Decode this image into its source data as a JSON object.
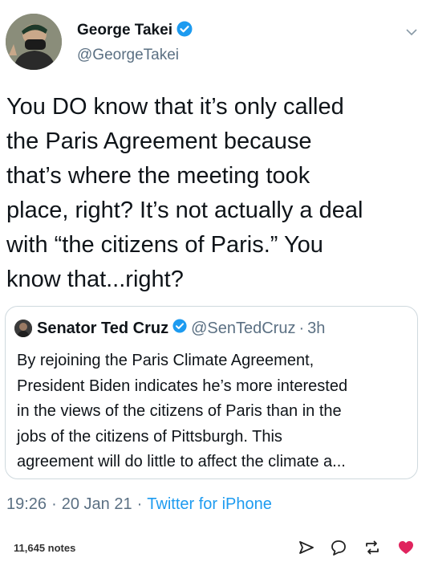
{
  "author": {
    "name": "George Takei",
    "handle": "@GeorgeTakei"
  },
  "tweet": {
    "lines": [
      "You DO know that it’s only called",
      "the Paris Agreement because",
      "that’s where the meeting took",
      "place, right? It’s not actually a deal",
      "with “the citizens of Paris.” You",
      "know that...right?"
    ]
  },
  "quote": {
    "name": "Senator Ted Cruz",
    "handle": "@SenTedCruz",
    "age": "3h",
    "lines": [
      "By rejoining the Paris Climate Agreement,",
      "President Biden indicates he’s more interested",
      "in the views of the citizens of Paris than in the",
      "jobs of the citizens of Pittsburgh. This",
      "agreement will do little to affect the climate a..."
    ]
  },
  "meta": {
    "time": "19:26",
    "date": "20 Jan 21",
    "source": "Twitter for iPhone",
    "separator": "·"
  },
  "footer": {
    "notes": "11,645 notes"
  },
  "colors": {
    "verified": "#1d9bf0",
    "secondary_text": "#5b7083",
    "border": "#cfd9de",
    "like": "#e0245e"
  },
  "icons": [
    "verified-badge-icon",
    "chevron-down-icon",
    "share-icon",
    "reply-icon",
    "reblog-icon",
    "heart-icon"
  ]
}
